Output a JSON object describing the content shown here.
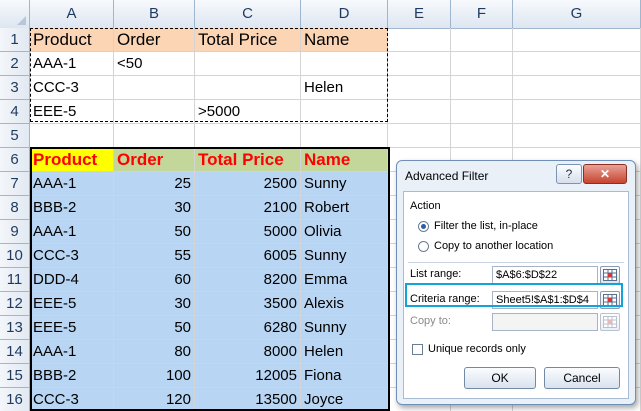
{
  "columns": [
    "A",
    "B",
    "C",
    "D",
    "E",
    "F",
    "G"
  ],
  "rows": [
    {
      "num": "1",
      "cells": [
        "Product",
        "Order",
        "Total Price",
        "Name"
      ]
    },
    {
      "num": "2",
      "cells": [
        "AAA-1",
        "<50",
        "",
        ""
      ]
    },
    {
      "num": "3",
      "cells": [
        "CCC-3",
        "",
        "",
        "Helen"
      ]
    },
    {
      "num": "4",
      "cells": [
        "EEE-5",
        "",
        ">5000",
        ""
      ]
    },
    {
      "num": "5",
      "cells": [
        "",
        "",
        "",
        ""
      ]
    },
    {
      "num": "6",
      "cells": [
        "Product",
        "Order",
        "Total Price",
        "Name"
      ]
    },
    {
      "num": "7",
      "cells": [
        "AAA-1",
        "25",
        "2500",
        "Sunny"
      ]
    },
    {
      "num": "8",
      "cells": [
        "BBB-2",
        "30",
        "2100",
        "Robert"
      ]
    },
    {
      "num": "9",
      "cells": [
        "AAA-1",
        "50",
        "5000",
        "Olivia"
      ]
    },
    {
      "num": "10",
      "cells": [
        "CCC-3",
        "55",
        "6005",
        "Sunny"
      ]
    },
    {
      "num": "11",
      "cells": [
        "DDD-4",
        "60",
        "8200",
        "Emma"
      ]
    },
    {
      "num": "12",
      "cells": [
        "EEE-5",
        "30",
        "3500",
        "Alexis"
      ]
    },
    {
      "num": "13",
      "cells": [
        "EEE-5",
        "50",
        "6280",
        "Sunny"
      ]
    },
    {
      "num": "14",
      "cells": [
        "AAA-1",
        "80",
        "8000",
        "Helen"
      ]
    },
    {
      "num": "15",
      "cells": [
        "BBB-2",
        "100",
        "12005",
        "Fiona"
      ]
    },
    {
      "num": "16",
      "cells": [
        "CCC-3",
        "120",
        "13500",
        "Joyce"
      ]
    }
  ],
  "colors": {
    "criteria_header": "#fcd5b4",
    "data_header": "#c4d79b",
    "data_header_text": "#ff0000",
    "data_fill": "#b8d6f3",
    "active_cell": "#ffff00",
    "highlight": "#13a3d9"
  },
  "dialog": {
    "title": "Advanced Filter",
    "help": "?",
    "close": "✕",
    "action_label": "Action",
    "radio_filter": "Filter the list, in-place",
    "radio_copy": "Copy to another location",
    "list_range_label": "List range:",
    "list_range_value": "$A$6:$D$22",
    "criteria_range_label": "Criteria range:",
    "criteria_range_value": "Sheet5!$A$1:$D$4",
    "copy_to_label": "Copy to:",
    "copy_to_value": "",
    "unique_label": "Unique records only",
    "ok": "OK",
    "cancel": "Cancel",
    "selected_action": "filter",
    "unique_checked": false
  }
}
